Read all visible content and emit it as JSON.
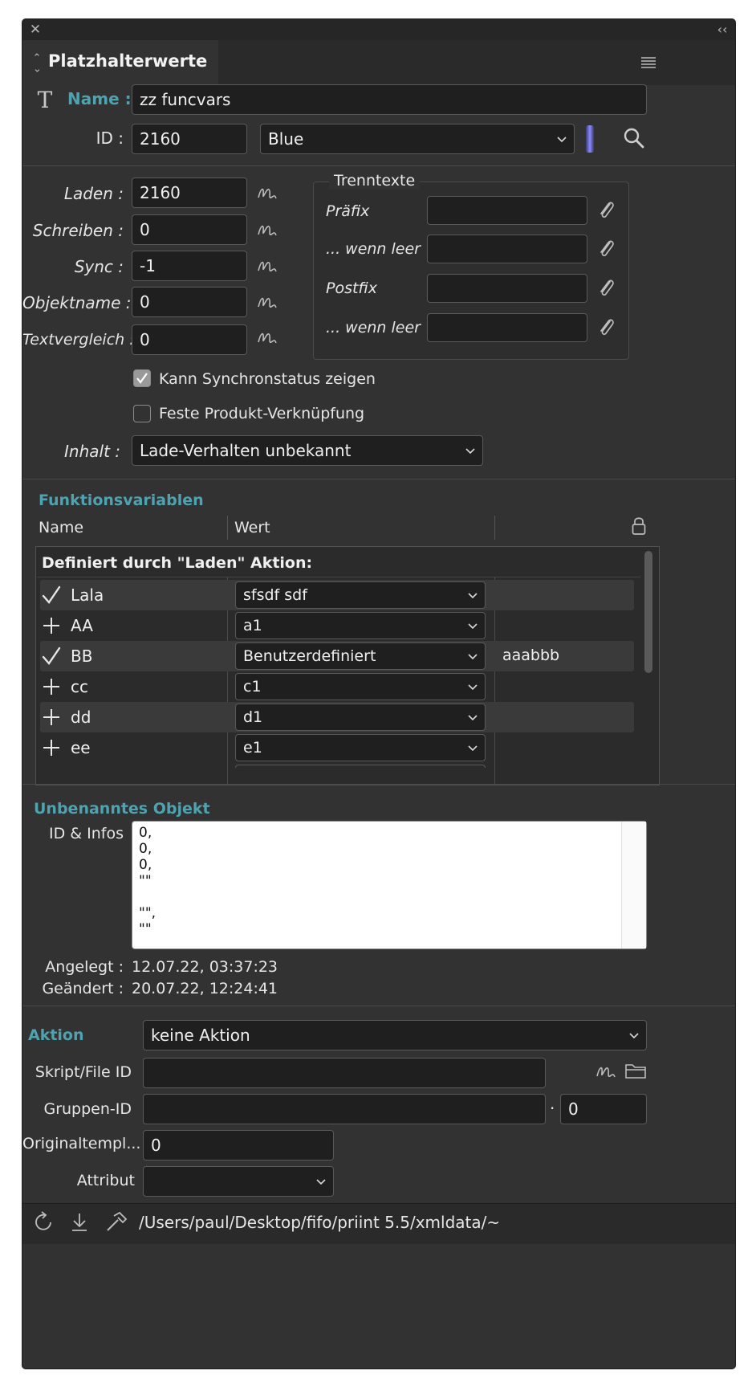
{
  "panel": {
    "title": "Platzhalterwerte",
    "collapse_glyph": "‹‹"
  },
  "header": {
    "name_label": "Name :",
    "name_value": "zz funcvars",
    "id_label": "ID :",
    "id_value": "2160",
    "color_value": "Blue",
    "accent_color": "#8a8aff"
  },
  "scripts": {
    "laden_label": "Laden :",
    "laden_value": "2160",
    "schreiben_label": "Schreiben :",
    "schreiben_value": "0",
    "sync_label": "Sync :",
    "sync_value": "-1",
    "objektname_label": "Objektname :",
    "objektname_value": "0",
    "textvergleich_label": "Textvergleich :",
    "textvergleich_value": "0"
  },
  "trenntexte": {
    "title": "Trenntexte",
    "praefix_label": "Präfix",
    "wenn_leer_1_label": "... wenn leer",
    "postfix_label": "Postfix",
    "wenn_leer_2_label": "... wenn leer"
  },
  "options": {
    "sync_status_label": "Kann Synchronstatus zeigen",
    "sync_status_checked": true,
    "produkt_label": "Feste Produkt-Verknüpfung",
    "produkt_checked": false,
    "inhalt_label": "Inhalt :",
    "inhalt_value": "Lade-Verhalten unbekannt"
  },
  "funktionsvariablen": {
    "title": "Funktionsvariablen",
    "col_name": "Name",
    "col_wert": "Wert",
    "group_header": "Definiert durch \"Laden\" Aktion:",
    "rows": [
      {
        "mark": "✓",
        "name": "Lala",
        "wert": "sfsdf sdf",
        "extra": ""
      },
      {
        "mark": "+",
        "name": "AA",
        "wert": "a1",
        "extra": ""
      },
      {
        "mark": "✓",
        "name": "BB",
        "wert": "Benutzerdefiniert",
        "extra": "aaabbb"
      },
      {
        "mark": "+",
        "name": "cc",
        "wert": "c1",
        "extra": ""
      },
      {
        "mark": "+",
        "name": "dd",
        "wert": "d1",
        "extra": ""
      },
      {
        "mark": "+",
        "name": "ee",
        "wert": "e1",
        "extra": ""
      }
    ]
  },
  "objekt": {
    "title": "Unbenanntes Objekt",
    "infos_label": "ID & Infos",
    "infos_text": "0,\n0,\n0,\n\"\"\n\n\"\",\n\"\"",
    "angelegt_label": "Angelegt :",
    "angelegt_value": "12.07.22, 03:37:23",
    "geaendert_label": "Geändert :",
    "geaendert_value": "20.07.22, 12:24:41"
  },
  "aktion": {
    "title": "Aktion",
    "value": "keine Aktion",
    "skript_label": "Skript/File ID",
    "skript_value": "",
    "gruppen_label": "Gruppen-ID",
    "gruppen_value": "",
    "gruppen_dot": "·",
    "gruppen_value2": "0",
    "original_label": "Originaltempl...",
    "original_value": "0",
    "attribut_label": "Attribut",
    "attribut_value": ""
  },
  "footer": {
    "path": "/Users/paul/Desktop/fifo/priint 5.5/xmldata/~"
  }
}
